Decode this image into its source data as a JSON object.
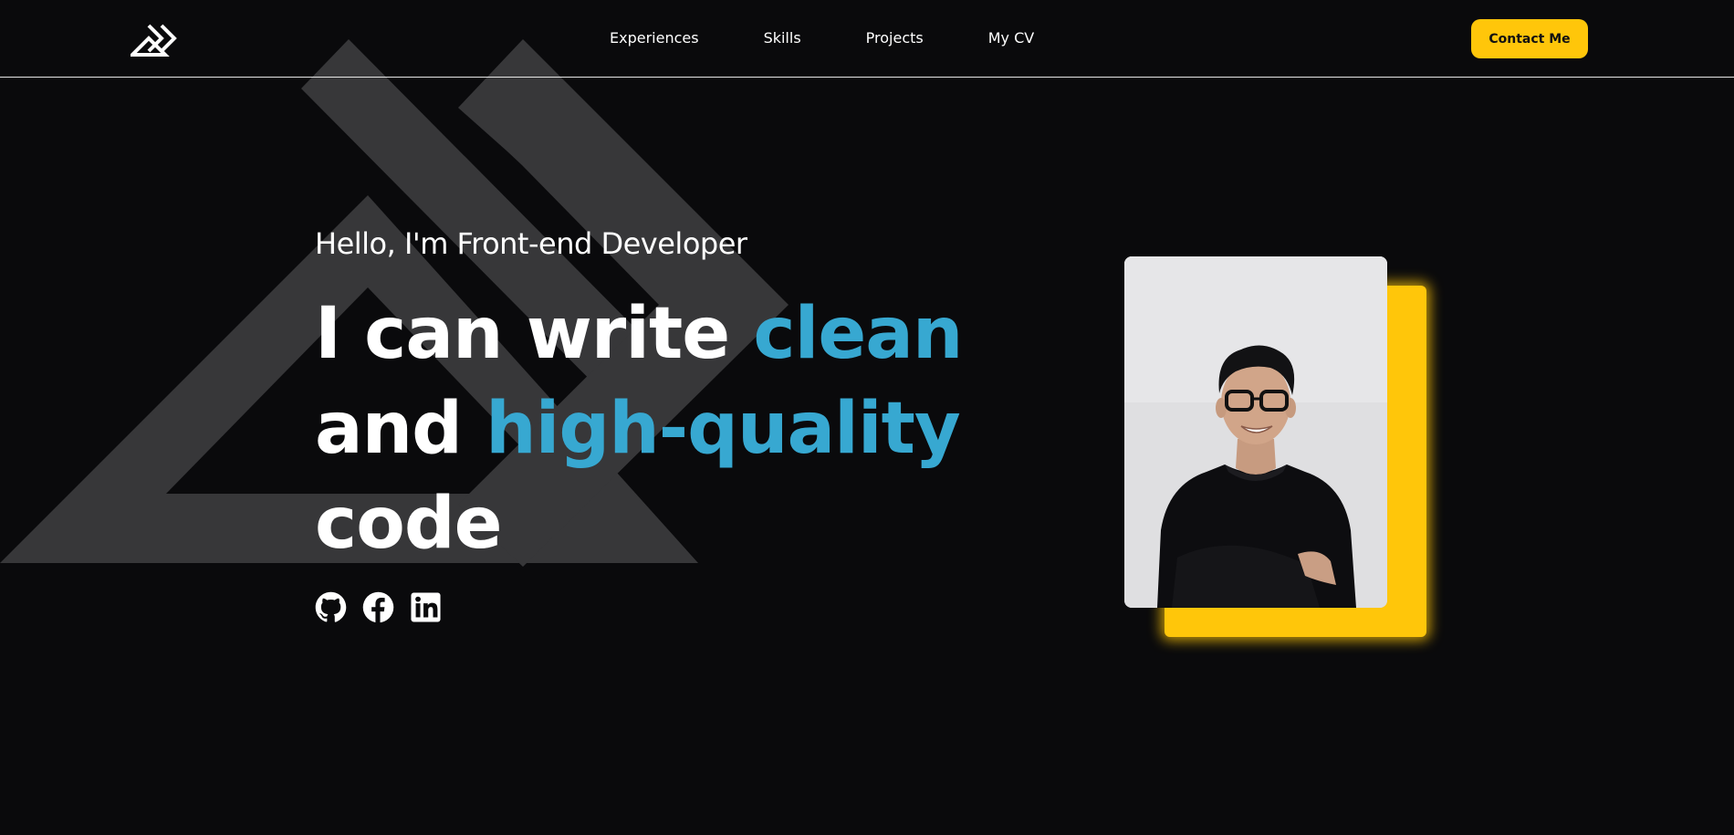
{
  "nav": {
    "links": [
      "Experiences",
      "Skills",
      "Projects",
      "My CV"
    ],
    "contact_label": "Contact Me"
  },
  "hero": {
    "greeting": "Hello, I'm Front-end Developer",
    "headline": {
      "line1_plain": "I can write ",
      "line1_accent": "clean",
      "line2_plain": "and ",
      "line2_accent": "high-quality",
      "line3_plain": "code"
    },
    "socials": [
      "github-icon",
      "facebook-icon",
      "linkedin-icon"
    ]
  },
  "colors": {
    "background": "#0a0a0c",
    "accent_blue": "#37a8d1",
    "accent_yellow": "#ffc60a",
    "chevron_gray": "#3a3a3c"
  },
  "logo": "double-chevron-logo-icon"
}
